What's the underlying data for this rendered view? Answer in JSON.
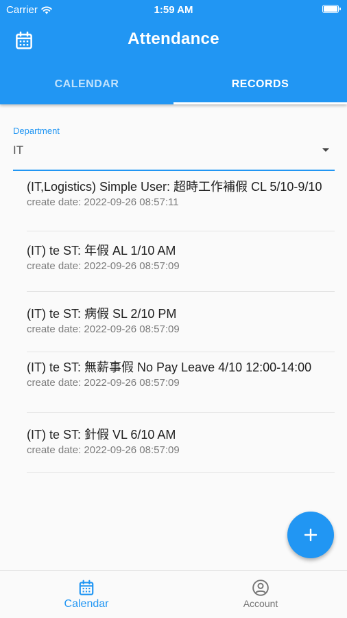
{
  "status_bar": {
    "carrier": "Carrier",
    "time": "1:59 AM"
  },
  "header": {
    "title": "Attendance",
    "calendar_icon": "calendar-icon"
  },
  "tabs": [
    {
      "label": "CALENDAR",
      "active": false
    },
    {
      "label": "RECORDS",
      "active": true
    }
  ],
  "department": {
    "label": "Department",
    "value": "IT"
  },
  "records": [
    {
      "title": "(IT,Logistics) Simple User: 超時工作補假 CL 5/10-9/10",
      "date": "create date: 2022-09-26 08:57:11"
    },
    {
      "title": "(IT) te ST: 年假 AL 1/10 AM",
      "date": "create date: 2022-09-26 08:57:09"
    },
    {
      "title": "(IT) te ST: 病假 SL 2/10 PM",
      "date": "create date: 2022-09-26 08:57:09"
    },
    {
      "title": "(IT) te ST: 無薪事假 No Pay Leave 4/10 12:00-14:00",
      "date": "create date: 2022-09-26 08:57:09"
    },
    {
      "title": "(IT) te ST: 針假 VL 6/10 AM",
      "date": "create date: 2022-09-26 08:57:09"
    }
  ],
  "fab": {
    "icon": "plus-icon"
  },
  "bottom_nav": [
    {
      "label": "Calendar",
      "icon": "calendar-icon",
      "active": true
    },
    {
      "label": "Account",
      "icon": "account-icon",
      "active": false
    }
  ],
  "colors": {
    "primary": "#2196f3",
    "background": "#fafafa"
  }
}
